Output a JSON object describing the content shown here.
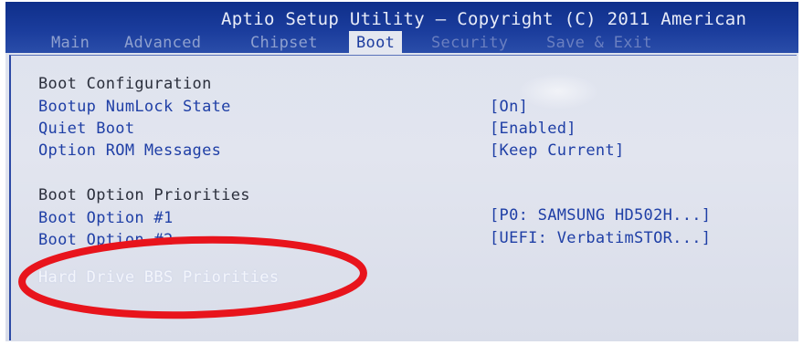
{
  "header": {
    "title": "Aptio Setup Utility – Copyright (C) 2011 American"
  },
  "tabs": [
    {
      "label": "Main"
    },
    {
      "label": "Advanced"
    },
    {
      "label": "Chipset"
    },
    {
      "label": "Boot"
    },
    {
      "label": "Security"
    },
    {
      "label": "Save & Exit"
    }
  ],
  "boot_configuration": {
    "heading": "Boot Configuration",
    "items": [
      {
        "label": "Bootup NumLock State",
        "value": "[On]"
      },
      {
        "label": "Quiet Boot",
        "value": "[Enabled]"
      },
      {
        "label": "Option ROM Messages",
        "value": "[Keep Current]"
      }
    ]
  },
  "boot_option_priorities": {
    "heading": "Boot Option Priorities",
    "items": [
      {
        "label": "Boot Option #1",
        "value": "[P0: SAMSUNG HD502H...]"
      },
      {
        "label": "Boot Option #2",
        "value": "[UEFI: VerbatimSTOR...]"
      }
    ]
  },
  "selected_item": {
    "label": "Hard Drive BBS Priorities"
  },
  "colors": {
    "header_bg": "#1a3c9c",
    "item_text": "#1f3fa6",
    "annotation": "#e8141c"
  }
}
